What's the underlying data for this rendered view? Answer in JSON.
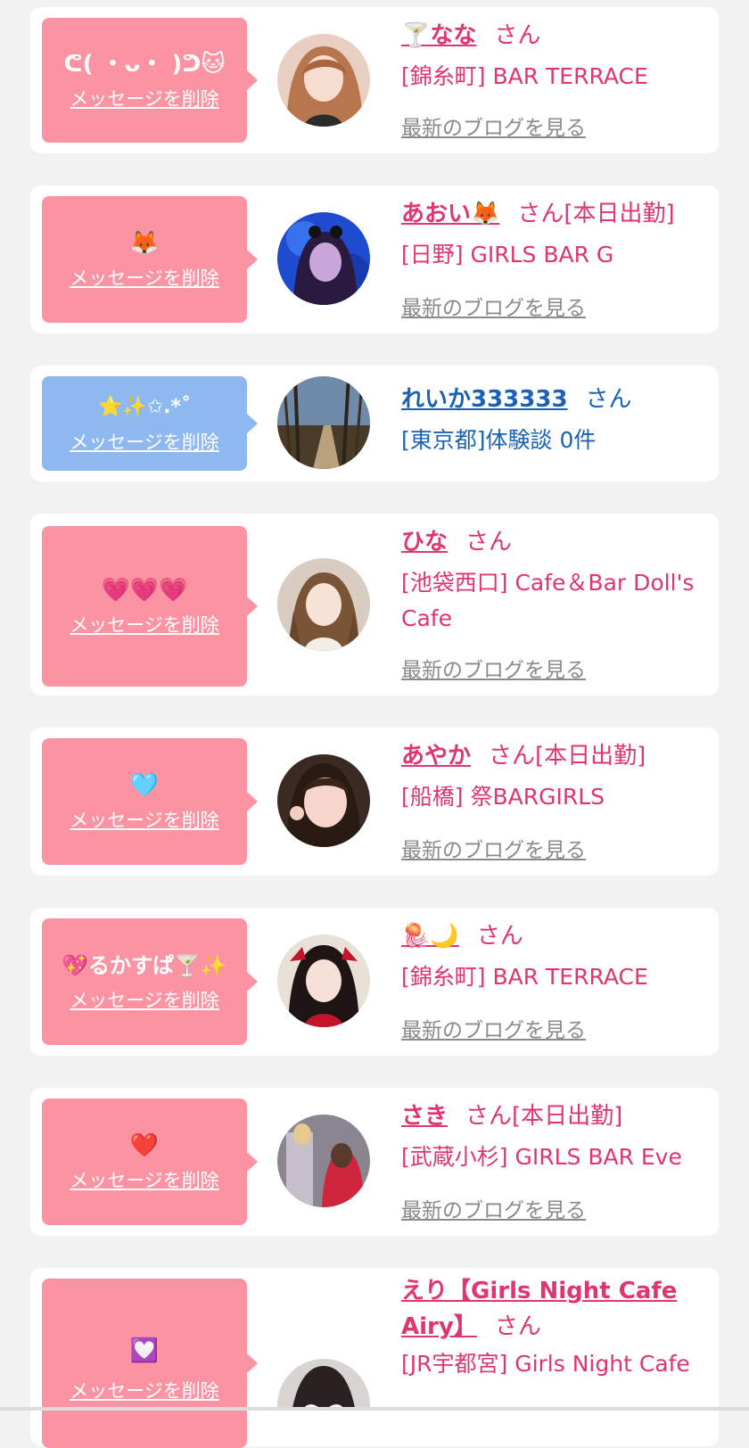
{
  "delete_label": "メッセージを削除",
  "san_label": "さん",
  "blog_label": "最新のブログを見る",
  "colors": {
    "background": "#f2f2f2",
    "card": "#ffffff",
    "pink_bubble": "#fb93a3",
    "blue_bubble": "#8db8f0",
    "pink_text": "#e0356e",
    "blue_text": "#1b62b5",
    "link_gray": "#8a8a8a"
  },
  "messages": [
    {
      "message": "ᕦ( ・ᴗ・ )ᕤ🐱",
      "name": "🍸なな",
      "status": "",
      "shop": "[錦糸町] BAR TERRACE",
      "avatar_icon": "girl-portrait-icon"
    },
    {
      "message": "🦊",
      "name": "あおい🦊",
      "status": "[本日出勤]",
      "shop": "[日野] GIRLS BAR G",
      "avatar_icon": "girl-portrait-icon"
    },
    {
      "message": "⭐✨✩.*˚",
      "name": "れいか333333",
      "status": "",
      "shop": "[東京都]体験談 0件",
      "avatar_icon": "forest-path-icon"
    },
    {
      "message": "💗💗💗",
      "name": "ひな",
      "status": "",
      "shop": "[池袋西口] Cafe＆Bar Doll's Cafe",
      "avatar_icon": "girl-portrait-icon"
    },
    {
      "message": "🩵",
      "name": "あやか",
      "status": "[本日出勤]",
      "shop": "[船橋] 祭BARGIRLS",
      "avatar_icon": "girl-portrait-icon"
    },
    {
      "message": "💖るかすぱ🍸✨",
      "name": "🪼🌙",
      "status": "",
      "shop": "[錦糸町] BAR TERRACE",
      "avatar_icon": "girl-portrait-icon"
    },
    {
      "message": "❤️",
      "name": "さき",
      "status": "[本日出勤]",
      "shop": "[武蔵小杉] GIRLS BAR Eve",
      "avatar_icon": "girl-portrait-icon"
    },
    {
      "message": "💟",
      "name": "えり【Girls Night Cafe Airy】",
      "status": "",
      "shop": "[JR宇都宮] Girls Night Cafe",
      "avatar_icon": "heart-cover-portrait-icon"
    }
  ]
}
